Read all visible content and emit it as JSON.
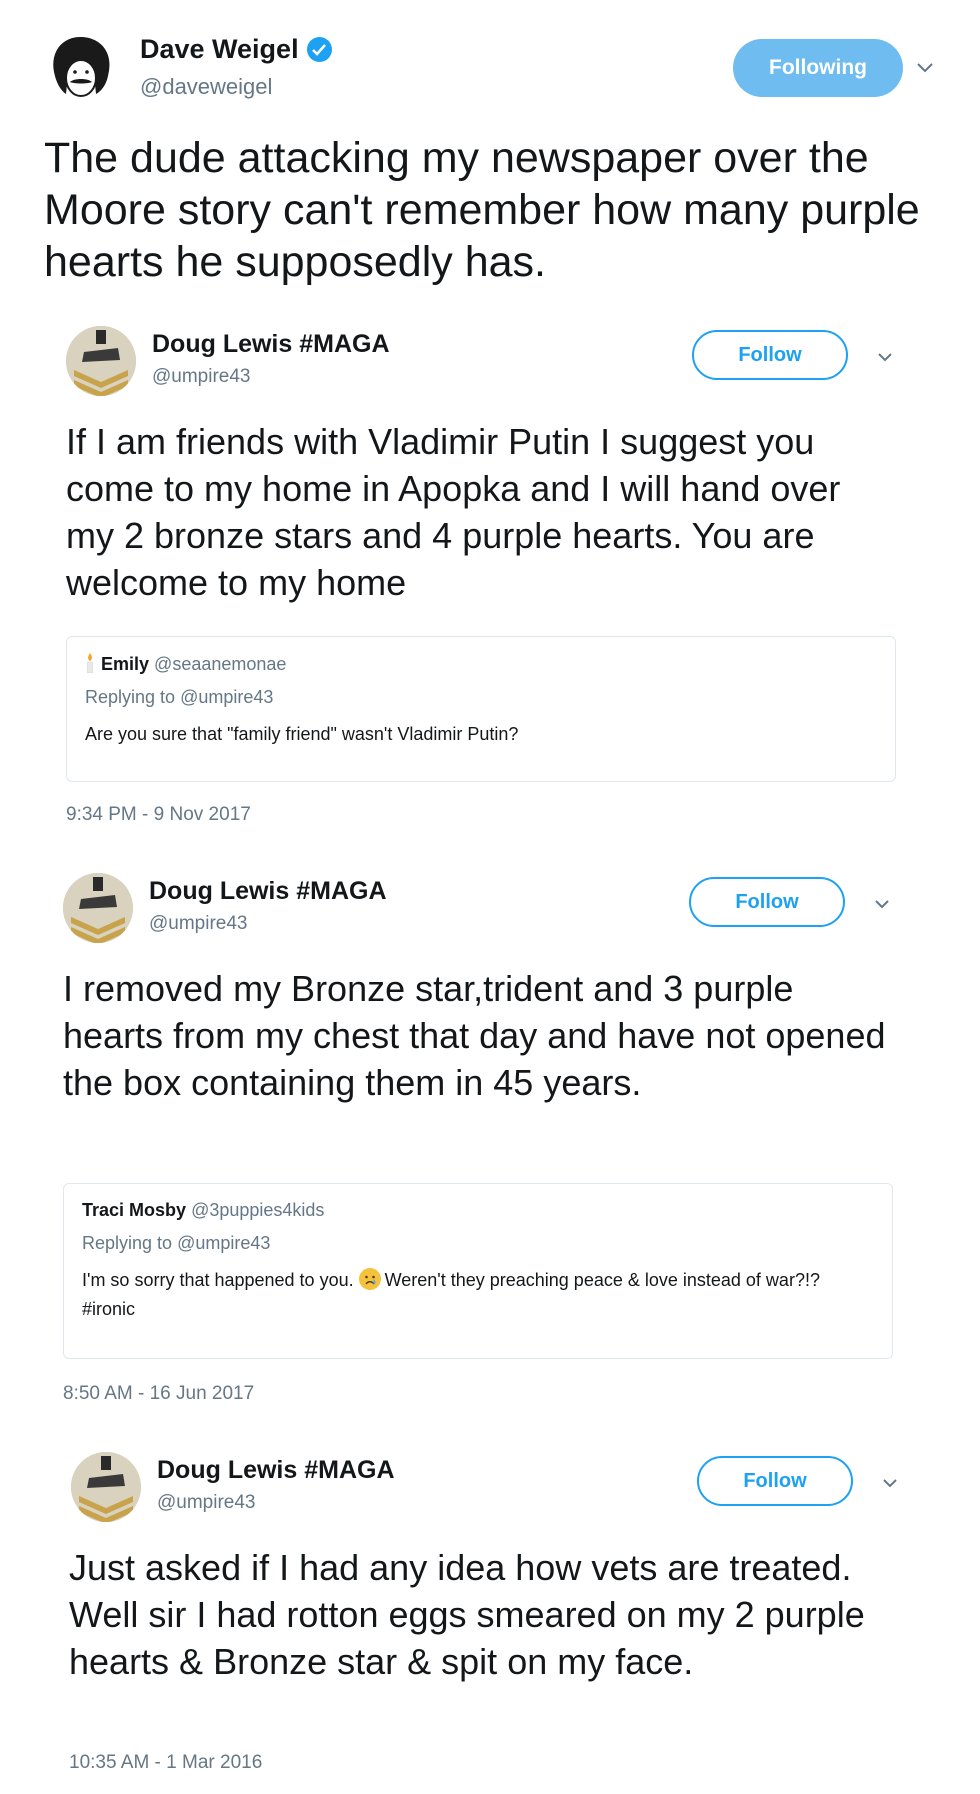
{
  "main": {
    "name": "Dave Weigel",
    "handle": "@daveweigel",
    "follow_button": "Following",
    "text": "The dude attacking my newspaper over the Moore story can't remember how many purple hearts he supposedly has."
  },
  "tweets": [
    {
      "name": "Doug Lewis #MAGA",
      "handle": "@umpire43",
      "follow_button": "Follow",
      "text": "If I am friends with Vladimir Putin I suggest you come to my home in Apopka and I will hand over my 2 bronze stars and 4 purple hearts. You are welcome to my home",
      "quote": {
        "name": "Emily",
        "handle": "@seaanemonae",
        "replying_prefix": "Replying to",
        "replying_to": "@umpire43",
        "text": "Are you sure that \"family friend\" wasn't Vladimir Putin?"
      },
      "time": "9:34 PM - 9 Nov 2017"
    },
    {
      "name": "Doug Lewis #MAGA",
      "handle": "@umpire43",
      "follow_button": "Follow",
      "text": "I removed my Bronze star,trident and 3 purple hearts from my chest that day and have not opened the box containing them in 45 years.",
      "quote": {
        "name": "Traci Mosby",
        "handle": "@3puppies4kids",
        "replying_prefix": "Replying to",
        "replying_to": "@umpire43",
        "text_before_emoji": "I'm so sorry that happened to you. ",
        "text_after_emoji": "Weren't they preaching peace & love instead of war?!? #ironic"
      },
      "time": "8:50 AM - 16 Jun 2017"
    },
    {
      "name": "Doug Lewis #MAGA",
      "handle": "@umpire43",
      "follow_button": "Follow",
      "text": "Just asked if I had any idea how vets are treated. Well sir I had rotton eggs smeared on my 2 purple hearts & Bronze star & spit on my face.",
      "time": "10:35 AM - 1 Mar 2016"
    }
  ],
  "colors": {
    "twitter_blue": "#1da1f2",
    "following_bg": "#6fbcf0",
    "secondary_text": "#657786",
    "border": "#e1e8ed"
  },
  "icons": [
    "verified-badge-icon",
    "chevron-down-icon",
    "candle-emoji-icon",
    "crying-face-emoji-icon"
  ]
}
